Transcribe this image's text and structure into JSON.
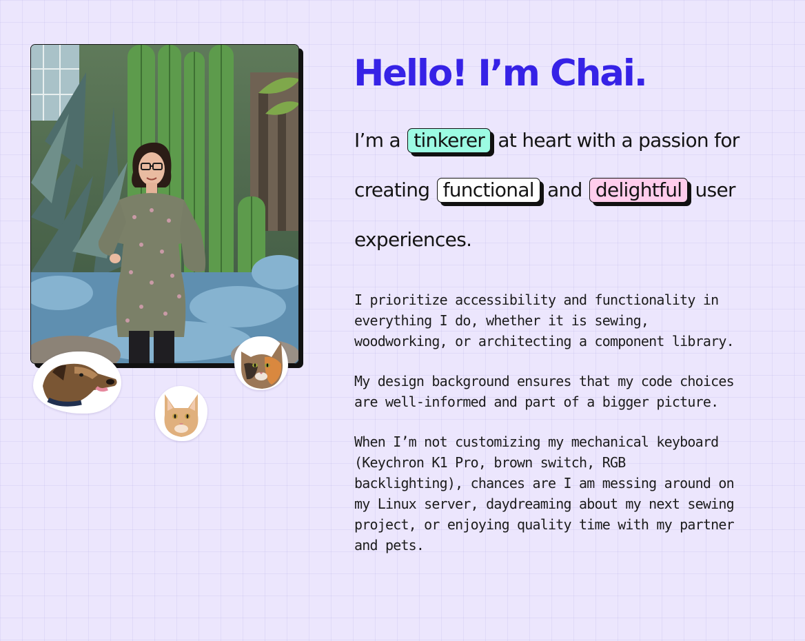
{
  "hero": {
    "heading": "Hello! I’m Chai.",
    "intro_part1": "I’m a",
    "chip_tinkerer": "tinkerer",
    "intro_part2": "at heart with a passion for creating",
    "chip_functional": "functional",
    "intro_part3": "and",
    "chip_delightful": "delightful",
    "intro_part4": "user experiences."
  },
  "about": {
    "paragraphs": [
      "I prioritize accessibility and functionality in everything I do, whether it is sewing, woodworking, or architecting a component library.",
      "My design background ensures that my code choices are well-informed and part of a bigger picture.",
      "When I’m not customizing my mechanical keyboard (Keychron K1 Pro, brown switch, RGB backlighting), chances are I am messing around on my Linux server, daydreaming about my next sewing project, or enjoying quality time with my partner and pets."
    ]
  },
  "colors": {
    "accent": "#3622e6",
    "background": "#ece6fd",
    "chip_mint": "#9cfbe3",
    "chip_pink": "#ffcdec",
    "chip_white": "#ffffff"
  },
  "images": {
    "portrait": "portrait-photo",
    "stickers": [
      "dog-sticker",
      "orange-cat-sticker",
      "calico-cat-sticker"
    ]
  }
}
